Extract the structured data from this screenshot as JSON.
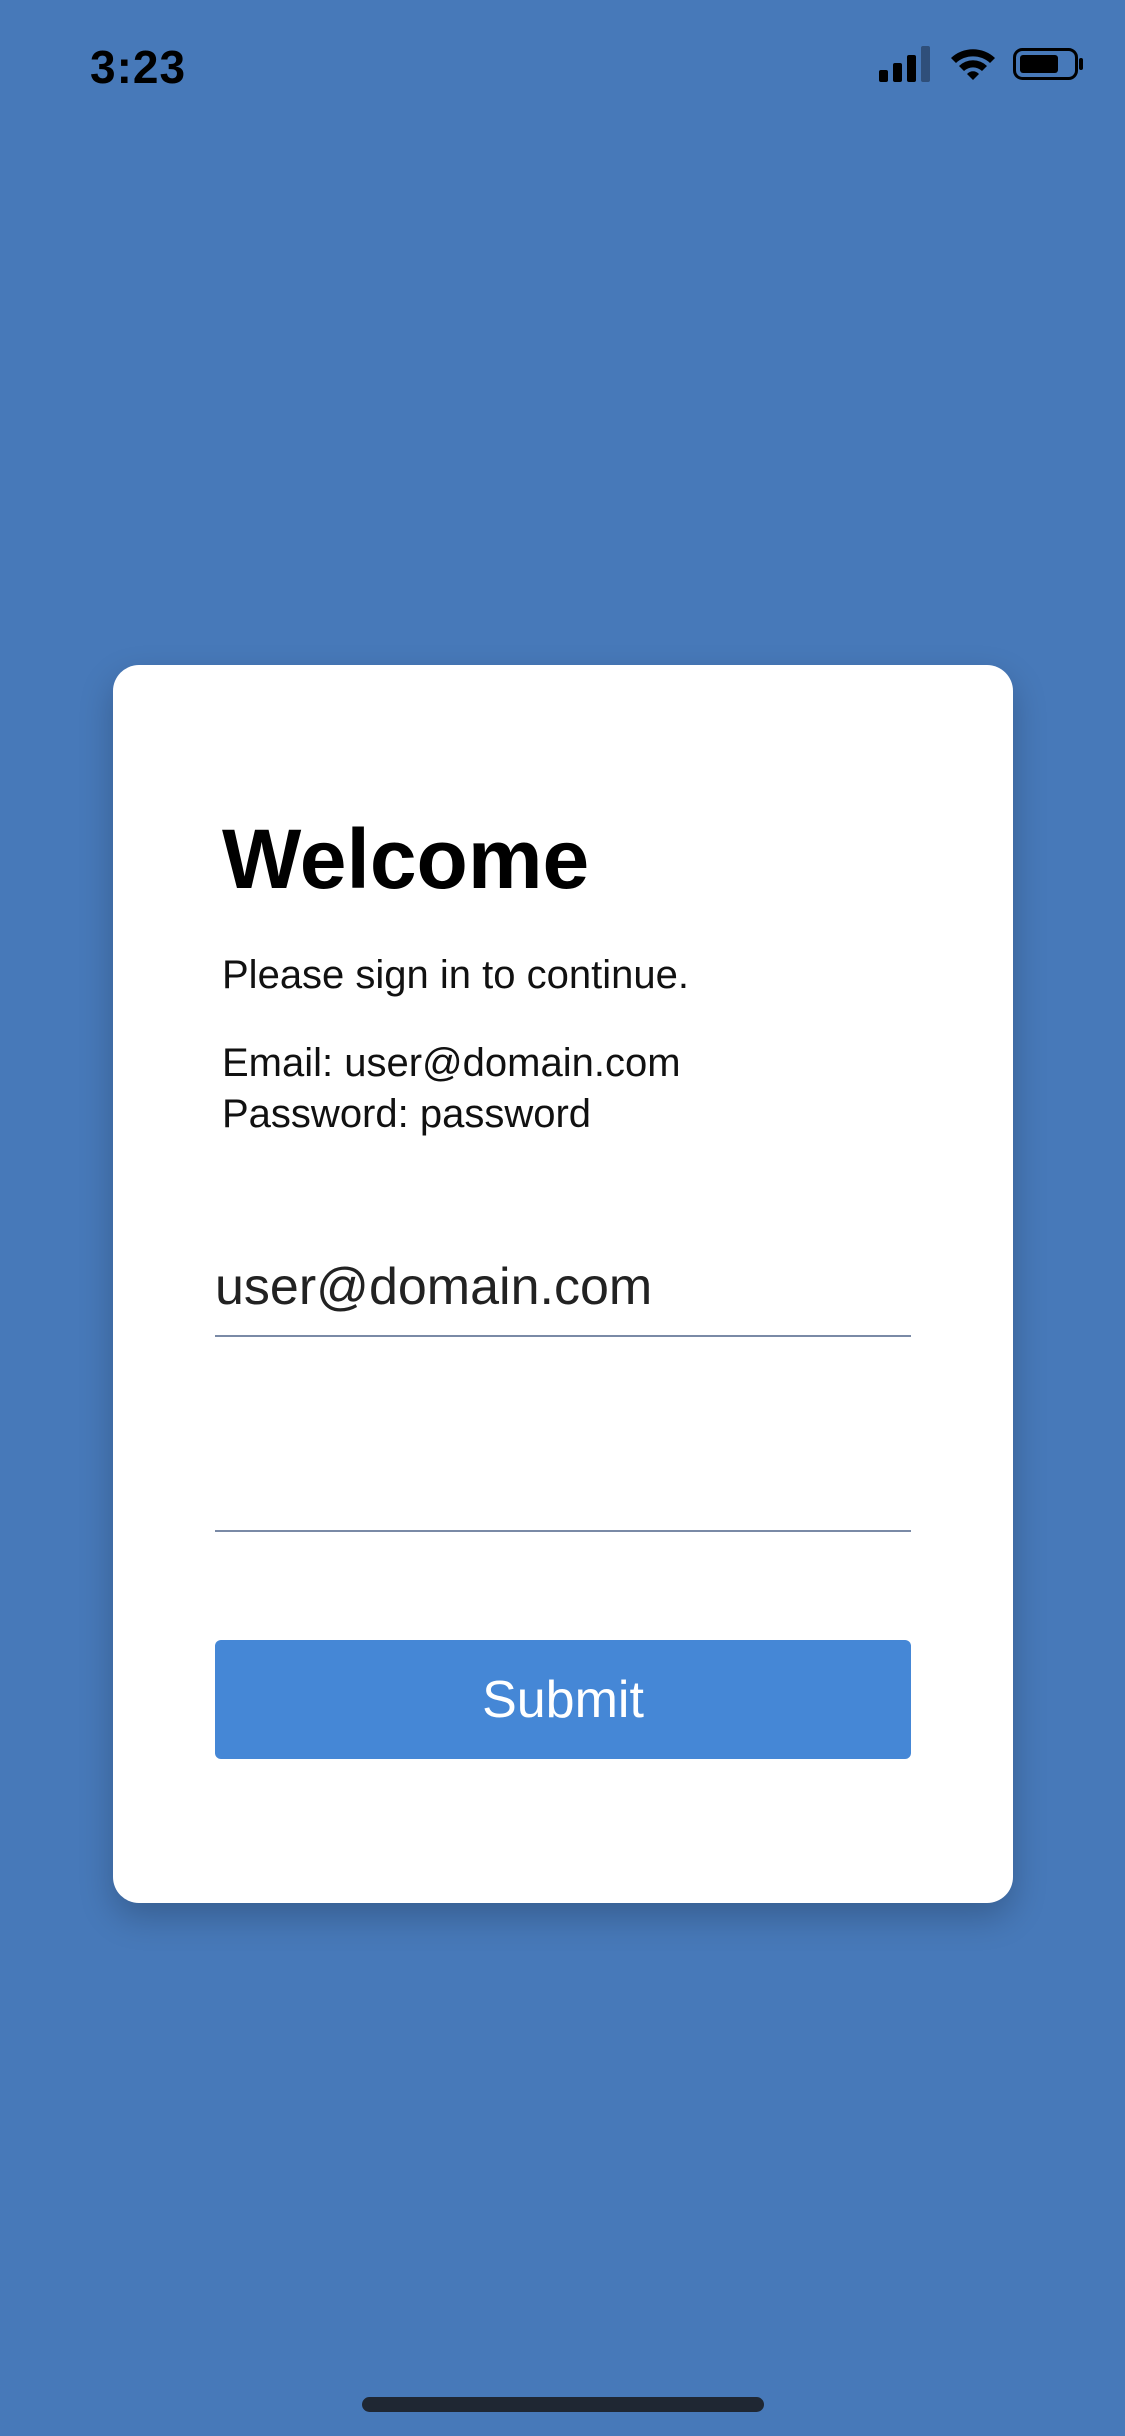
{
  "status_bar": {
    "time": "3:23",
    "icons": [
      "signal-icon",
      "wifi-icon",
      "battery-icon"
    ]
  },
  "login_card": {
    "title": "Welcome",
    "subtitle": "Please sign in to continue.",
    "hint_email": "Email: user@domain.com",
    "hint_password": "Password: password",
    "email_value": "user@domain.com",
    "password_value": "",
    "submit_label": "Submit"
  },
  "colors": {
    "background": "#4779b9",
    "card": "#ffffff",
    "button": "#4587d6",
    "button_text": "#ffffff"
  }
}
